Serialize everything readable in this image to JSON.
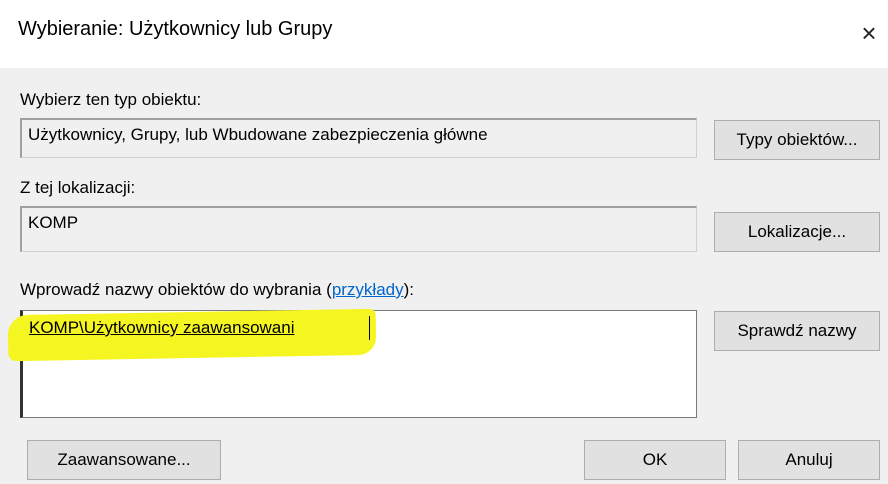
{
  "window": {
    "title": "Wybieranie: Użytkownicy lub Grupy",
    "close_glyph": "×",
    "close_icon": "close-icon"
  },
  "object_type": {
    "label": "Wybierz ten typ obiektu:",
    "value": "Użytkownicy, Grupy, lub Wbudowane zabezpieczenia główne",
    "button": "Typy obiektów..."
  },
  "location": {
    "label": "Z tej lokalizacji:",
    "value": "KOMP",
    "button": "Lokalizacje..."
  },
  "names": {
    "label_prefix": "Wprowadź nazwy obiektów do wybrania (",
    "label_link": "przykłady",
    "label_suffix": "):",
    "value": "KOMP\\Użytkownicy zaawansowani",
    "highlight_color": "#f5f521",
    "check_button": "Sprawdź nazwy"
  },
  "footer": {
    "advanced_button": "Zaawansowane...",
    "ok_button": "OK",
    "cancel_button": "Anuluj"
  }
}
